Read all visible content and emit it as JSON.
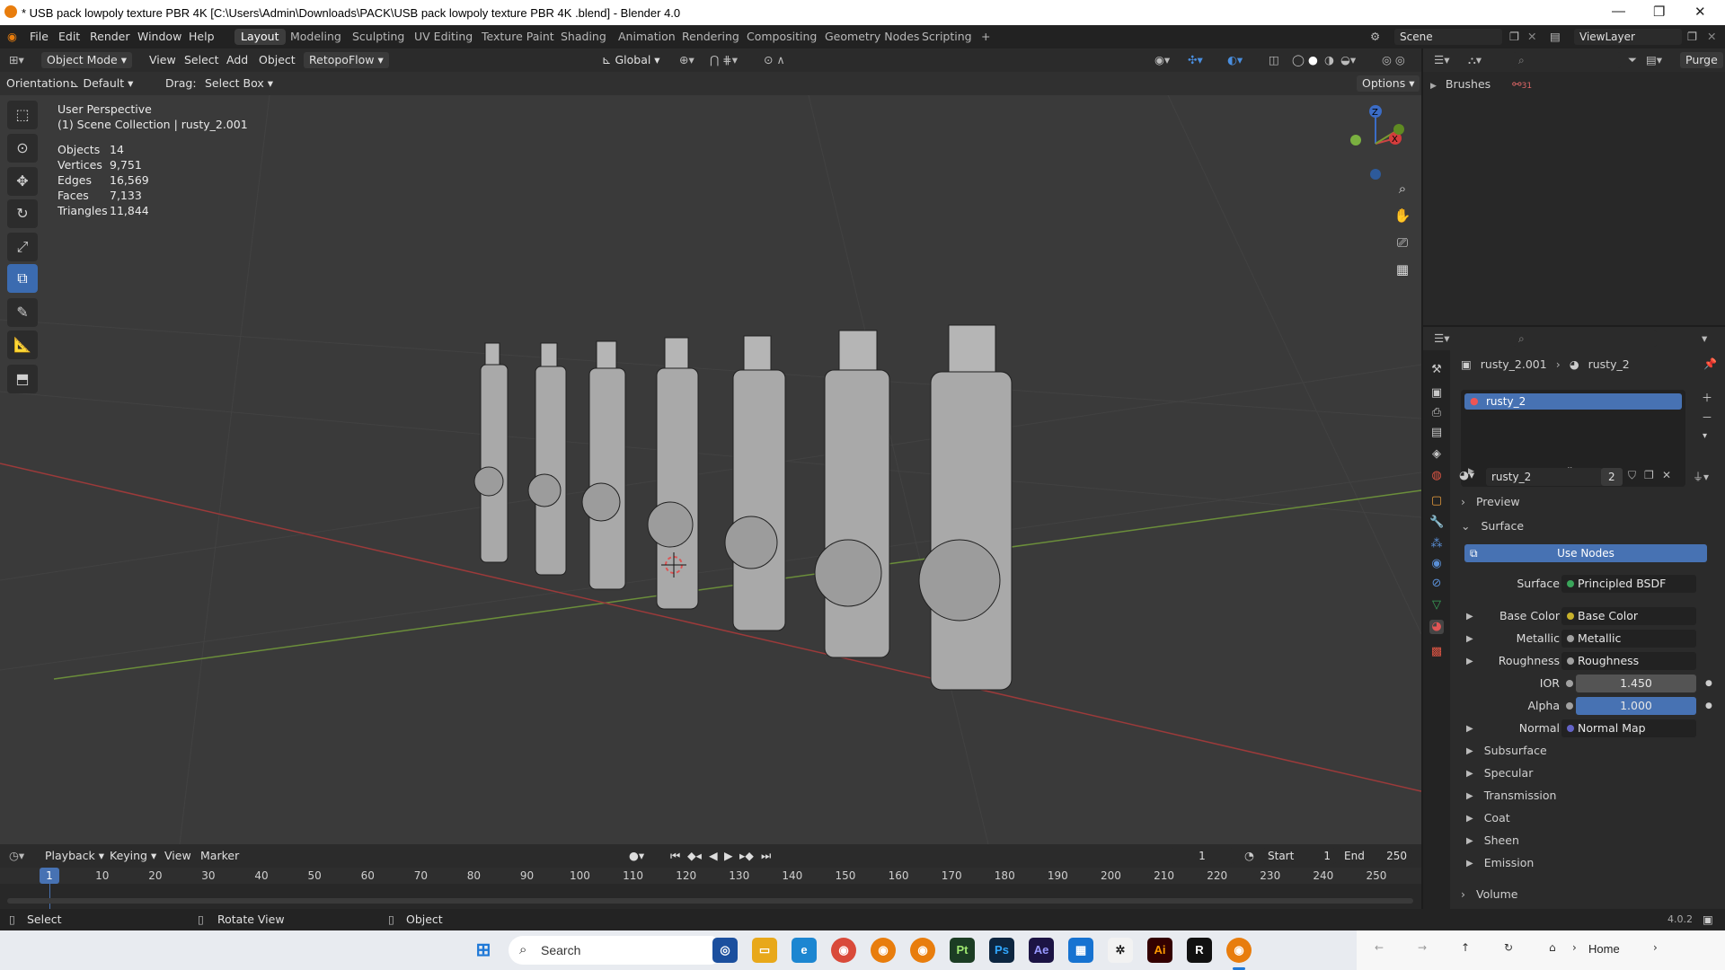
{
  "titlebar": {
    "title": "* USB pack lowpoly texture PBR 4K  [C:\\Users\\Admin\\Downloads\\PACK\\USB pack lowpoly texture PBR 4K .blend] - Blender 4.0",
    "minimize": "—",
    "maximize": "❐",
    "close": "✕"
  },
  "menubar": {
    "menus": [
      "File",
      "Edit",
      "Render",
      "Window",
      "Help"
    ],
    "workspaces": [
      "Layout",
      "Modeling",
      "Sculpting",
      "UV Editing",
      "Texture Paint",
      "Shading",
      "Animation",
      "Rendering",
      "Compositing",
      "Geometry Nodes",
      "Scripting"
    ],
    "active_workspace": "Layout",
    "add_workspace": "+",
    "scene": "Scene",
    "view_layer": "ViewLayer"
  },
  "viewport": {
    "mode": "Object Mode",
    "menus": [
      "View",
      "Select",
      "Add",
      "Object"
    ],
    "addon_menu": "RetopoFlow",
    "transform_orientation": "Global",
    "orientation_label": "Orientation:",
    "orientation_value": "Default",
    "drag_label": "Drag:",
    "drag_value": "Select Box",
    "options": "Options",
    "overlay_title": "User Perspective",
    "overlay_collection": "(1) Scene Collection | rusty_2.001",
    "stats": [
      {
        "label": "Objects",
        "value": "14"
      },
      {
        "label": "Vertices",
        "value": "9,751"
      },
      {
        "label": "Edges",
        "value": "16,569"
      },
      {
        "label": "Faces",
        "value": "7,133"
      },
      {
        "label": "Triangles",
        "value": "11,844"
      }
    ],
    "gizmo_axes": {
      "z": "Z",
      "x": "X"
    },
    "tools": [
      "select-box-icon",
      "cursor-icon",
      "move-icon",
      "rotate-icon",
      "scale-icon",
      "transform-icon",
      "annotate-icon",
      "measure-icon",
      "add-cube-icon"
    ],
    "active_tool": "transform-icon"
  },
  "outliner": {
    "items": [
      {
        "label": "Brushes",
        "badge": "31"
      }
    ],
    "purge": "Purge"
  },
  "properties": {
    "breadcrumb_object": "rusty_2.001",
    "breadcrumb_material": "rusty_2",
    "slot_name": "rusty_2",
    "material_name": "rusty_2",
    "user_count": "2",
    "sections": {
      "preview": "Preview",
      "surface": "Surface",
      "volume": "Volume"
    },
    "use_nodes": "Use Nodes",
    "surface_label": "Surface",
    "surface_value": "Principled BSDF",
    "inputs": [
      {
        "label": "Base Color",
        "value": "Base Color",
        "dot": "#c7b12b",
        "kind": "link"
      },
      {
        "label": "Metallic",
        "value": "Metallic",
        "dot": "#a1a1a1",
        "kind": "link"
      },
      {
        "label": "Roughness",
        "value": "Roughness",
        "dot": "#a1a1a1",
        "kind": "link"
      },
      {
        "label": "IOR",
        "value": "1.450",
        "dot": "#a1a1a1",
        "kind": "number"
      },
      {
        "label": "Alpha",
        "value": "1.000",
        "dot": "#a1a1a1",
        "kind": "slider"
      },
      {
        "label": "Normal",
        "value": "Normal Map",
        "dot": "#6363c7",
        "kind": "link"
      }
    ],
    "subpanels": [
      "Subsurface",
      "Specular",
      "Transmission",
      "Coat",
      "Sheen",
      "Emission"
    ]
  },
  "timeline": {
    "menus": [
      "Playback",
      "Keying",
      "View",
      "Marker"
    ],
    "current_frame": "1",
    "start_label": "Start",
    "start": "1",
    "end_label": "End",
    "end": "250",
    "ruler": [
      "10",
      "20",
      "30",
      "40",
      "50",
      "60",
      "70",
      "80",
      "90",
      "100",
      "110",
      "120",
      "130",
      "140",
      "150",
      "160",
      "170",
      "180",
      "190",
      "200",
      "210",
      "220",
      "230",
      "240",
      "250"
    ],
    "playhead": "1"
  },
  "statusbar": {
    "items": [
      "Select",
      "Rotate View",
      "Object"
    ],
    "version": "4.0.2"
  },
  "taskbar": {
    "search": "Search",
    "explorer_path": "Home",
    "apps": [
      "Pt",
      "Ps",
      "Ae",
      "Ai",
      "R"
    ]
  }
}
